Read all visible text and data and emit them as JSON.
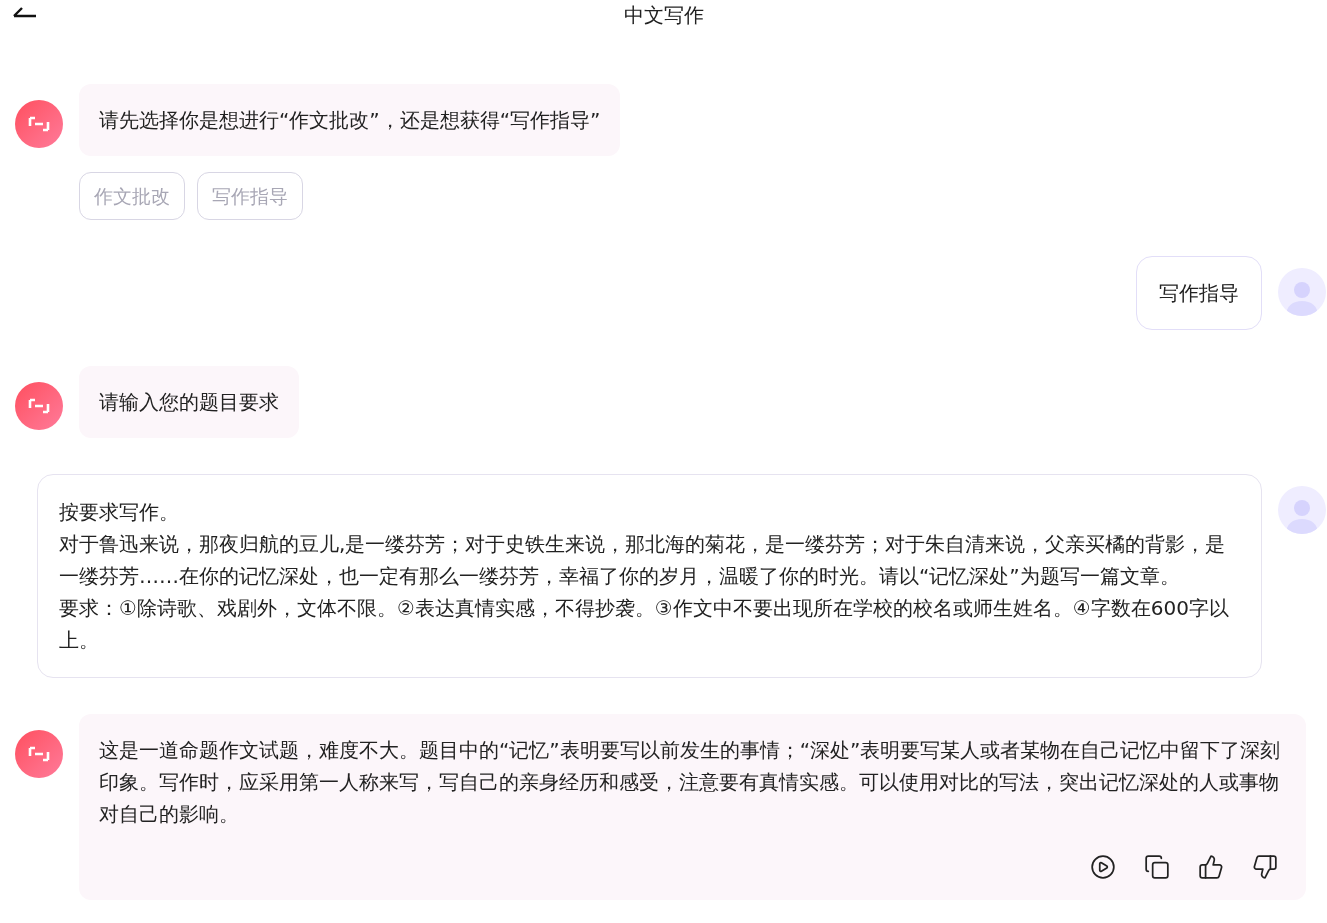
{
  "header": {
    "title": "中文写作"
  },
  "messages": [
    {
      "kind": "bot",
      "text": "请先选择你是想进行“作文批改”，还是想获得“写作指导”",
      "options": [
        "作文批改",
        "写作指导"
      ]
    },
    {
      "kind": "user",
      "text": "写作指导"
    },
    {
      "kind": "bot",
      "text": "请输入您的题目要求"
    },
    {
      "kind": "card",
      "lines": [
        "按要求写作。",
        "对于鲁迅来说，那夜归航的豆儿,是一缕芬芳；对于史铁生来说，那北海的菊花，是一缕芬芳；对于朱自清来说，父亲买橘的背影，是一缕芬芳……在你的记忆深处，也一定有那么一缕芬芳，幸福了你的岁月，温暖了你的时光。请以“记忆深处”为题写一篇文章。",
        "要求：①除诗歌、戏剧外，文体不限。②表达真情实感，不得抄袭。③作文中不要出现所在学校的校名或师生姓名。④字数在600字以上。"
      ]
    },
    {
      "kind": "bot",
      "text": "这是一道命题作文试题，难度不大。题目中的“记忆”表明要写以前发生的事情；“深处”表明要写某人或者某物在自己记忆中留下了深刻印象。写作时，应采用第一人称来写，写自己的亲身经历和感受，注意要有真情实感。可以使用对比的写法，突出记忆深处的人或事物对自己的影响。",
      "actions": true
    }
  ]
}
